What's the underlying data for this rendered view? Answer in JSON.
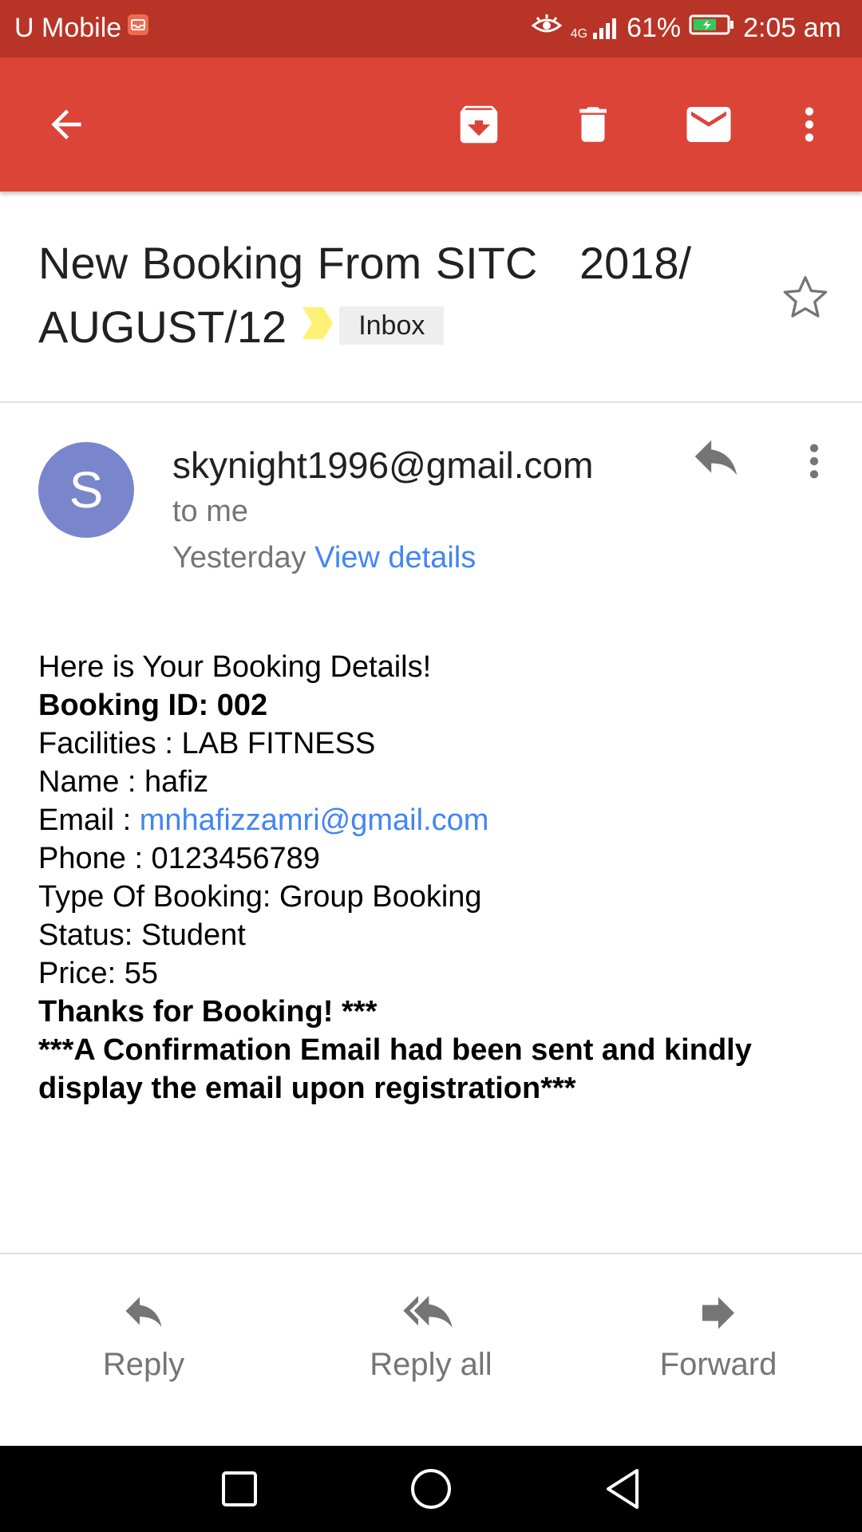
{
  "status_bar": {
    "carrier": "U Mobile",
    "network": "4G",
    "battery": "61%",
    "time": "2:05 am"
  },
  "toolbar": {
    "back_icon": "arrow-left",
    "archive_icon": "archive",
    "delete_icon": "trash",
    "mark_unread_icon": "envelope",
    "overflow_icon": "more-vertical"
  },
  "email": {
    "subject_line1": "New Booking From SITC   2018/",
    "subject_line2": "AUGUST/12",
    "label": "Inbox",
    "sender": "skynight1996@gmail.com",
    "avatar_letter": "S",
    "recipient": "to me",
    "date": "Yesterday",
    "view_details": "View details",
    "body": {
      "greeting": "Here is Your Booking Details!",
      "booking_id": "Booking ID: 002",
      "facilities": "Facilities : LAB FITNESS",
      "name": "Name : hafiz",
      "email_prefix": "Email : ",
      "email_link": "mnhafizzamri@gmail.com",
      "phone": "Phone : 0123456789",
      "type": "Type Of Booking: Group Booking",
      "status": "Status: Student",
      "price": "Price: 55",
      "thanks": "Thanks for Booking! ***",
      "confirmation": "***A Confirmation Email had been sent and kindly display the email upon registration***"
    }
  },
  "actions": {
    "reply": "Reply",
    "reply_all": "Reply all",
    "forward": "Forward"
  },
  "colors": {
    "status_bar": "#b83426",
    "toolbar": "#db4437",
    "avatar": "#7986cb",
    "link": "#4285f4",
    "importance_marker": "#fff176"
  }
}
